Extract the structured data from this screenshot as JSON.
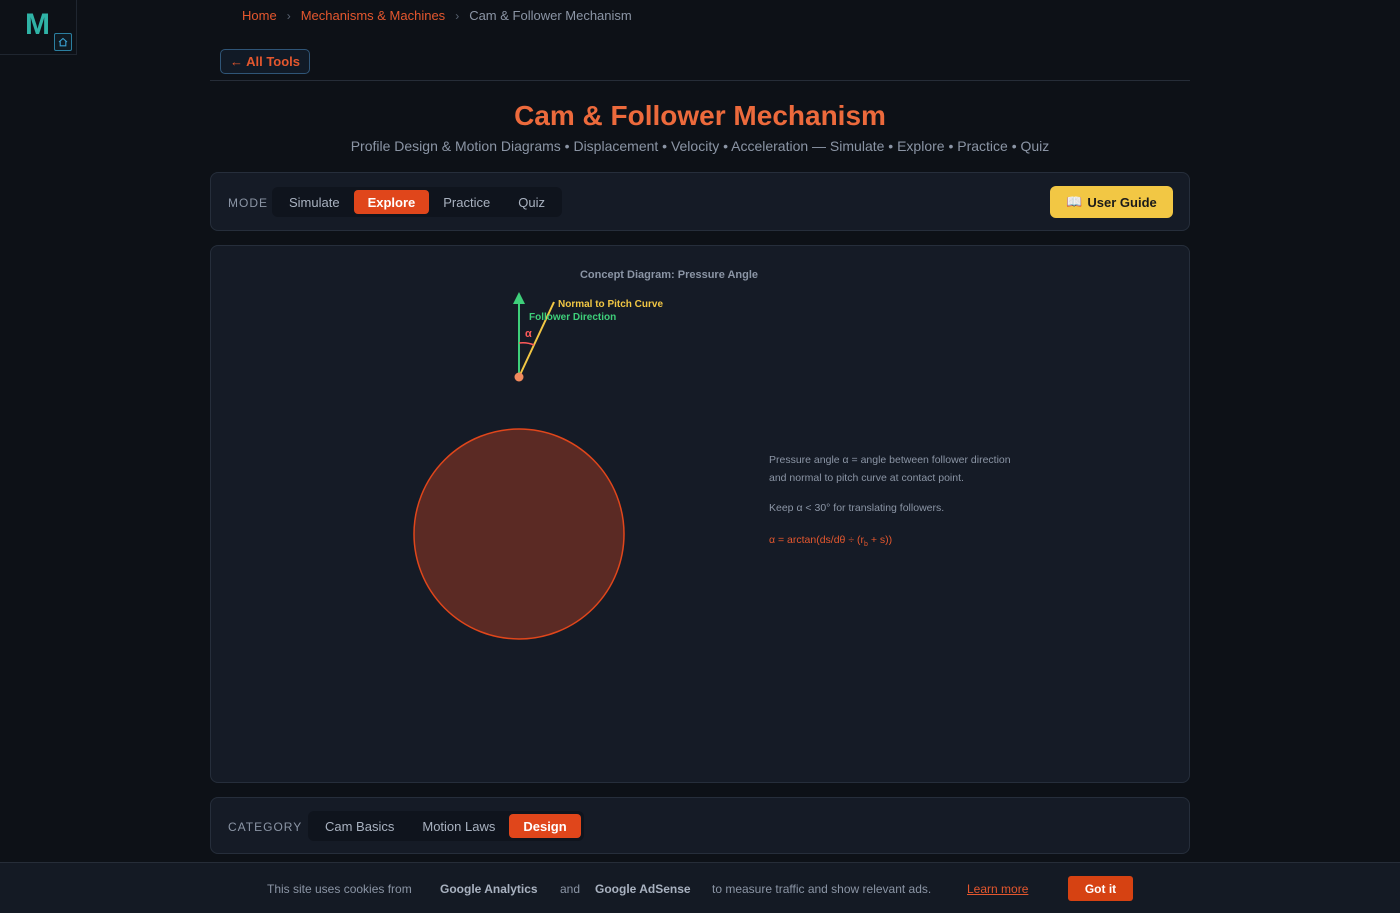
{
  "logo": {
    "letter": "M"
  },
  "breadcrumb": {
    "items": [
      "Home",
      "Mechanisms & Machines",
      "Cam & Follower Mechanism"
    ],
    "separator": "›"
  },
  "back_button": {
    "label": "← All Tools"
  },
  "page": {
    "title": "Cam & Follower Mechanism",
    "subtitle": "Profile Design & Motion Diagrams • Displacement • Velocity • Acceleration — Simulate • Explore • Practice • Quiz"
  },
  "mode": {
    "label": "MODE",
    "tabs": [
      "Simulate",
      "Explore",
      "Practice",
      "Quiz"
    ],
    "active": "Explore"
  },
  "user_guide": {
    "icon": "book-icon",
    "glyph": "📖",
    "label": "User Guide"
  },
  "diagram": {
    "title": "Concept Diagram: Pressure Angle",
    "normal_label": "Normal to Pitch Curve",
    "follower_label": "Follower Direction",
    "alpha": "α",
    "desc_line1": "Pressure angle α = angle between follower direction",
    "desc_line2": "and normal to pitch curve at contact point.",
    "tip": "Keep α < 30° for translating followers.",
    "formula_pre": "α = arctan(ds/dθ ÷ (r",
    "formula_sub": "b",
    "formula_post": " + s))",
    "colors": {
      "cam_fill": "#5b2a24",
      "cam_stroke": "#e0461b",
      "follower": "#3ecf7a",
      "normal": "#f2c744",
      "alpha": "#ff5a5a",
      "contact": "#f08a5d",
      "formula": "#e4572e"
    }
  },
  "category": {
    "label": "CATEGORY",
    "tabs": [
      "Cam Basics",
      "Motion Laws",
      "Design"
    ],
    "active": "Design"
  },
  "cookie": {
    "t1": "This site uses cookies from",
    "ga": "Google Analytics",
    "and": "and",
    "ads": "Google AdSense",
    "t2": "to measure traffic and show relevant ads.",
    "learn_more": "Learn more",
    "button": "Got it"
  }
}
